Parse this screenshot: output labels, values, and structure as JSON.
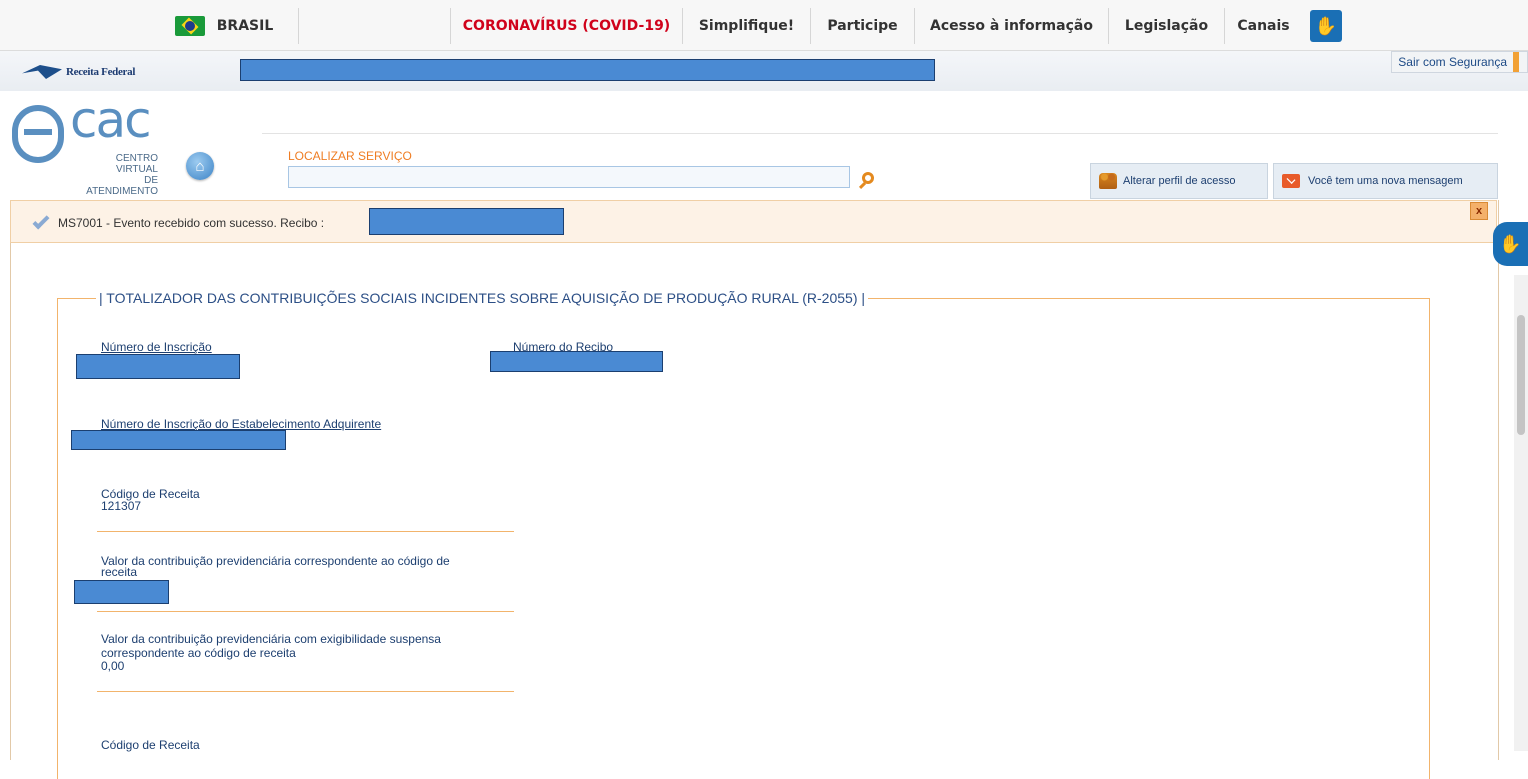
{
  "gov_bar": {
    "brasil": "BRASIL",
    "covid": "CORONAVÍRUS (COVID-19)",
    "simplifique": "Simplifique!",
    "participe": "Participe",
    "acesso": "Acesso à informação",
    "legislacao": "Legislação",
    "canais": "Canais"
  },
  "receita": {
    "logo_text": "Receita Federal",
    "logout": "Sair com Segurança"
  },
  "ecac": {
    "letters": "cac",
    "subtitle_1": "CENTRO VIRTUAL",
    "subtitle_2": "DE ATENDIMENTO"
  },
  "search": {
    "label": "LOCALIZAR SERVIÇO",
    "value": "",
    "placeholder": ""
  },
  "header_buttons": {
    "alterar": "Alterar perfil de acesso",
    "mensagem": "Você tem uma nova mensagem"
  },
  "alert": {
    "text": "MS7001 - Evento recebido com sucesso. Recibo :",
    "close": "x"
  },
  "form": {
    "legend": "| TOTALIZADOR DAS CONTRIBUIÇÕES SOCIAIS INCIDENTES SOBRE AQUISIÇÃO DE PRODUÇÃO RURAL (R-2055) |",
    "numero_inscricao": "Número de Inscrição",
    "numero_recibo": "Número do Recibo",
    "inscricao_estab": "Número de Inscrição do Estabelecimento Adquirente",
    "codigo_receita_label": "Código de Receita",
    "codigo_receita_value": "121307",
    "valor_contrib_label_1": "Valor da contribuição previdenciária correspondente ao código de",
    "valor_contrib_label_2": "receita",
    "valor_susp_label_1": "Valor da contribuição previdenciária com exigibilidade suspensa",
    "valor_susp_label_2": "correspondente ao código de receita",
    "valor_susp_value": "0,00",
    "codigo_receita_label_2": "Código de Receita"
  },
  "colors": {
    "accent": "#ef7d23",
    "brand_blue": "#1d4f8b",
    "redaction": "#4a8ad3"
  }
}
